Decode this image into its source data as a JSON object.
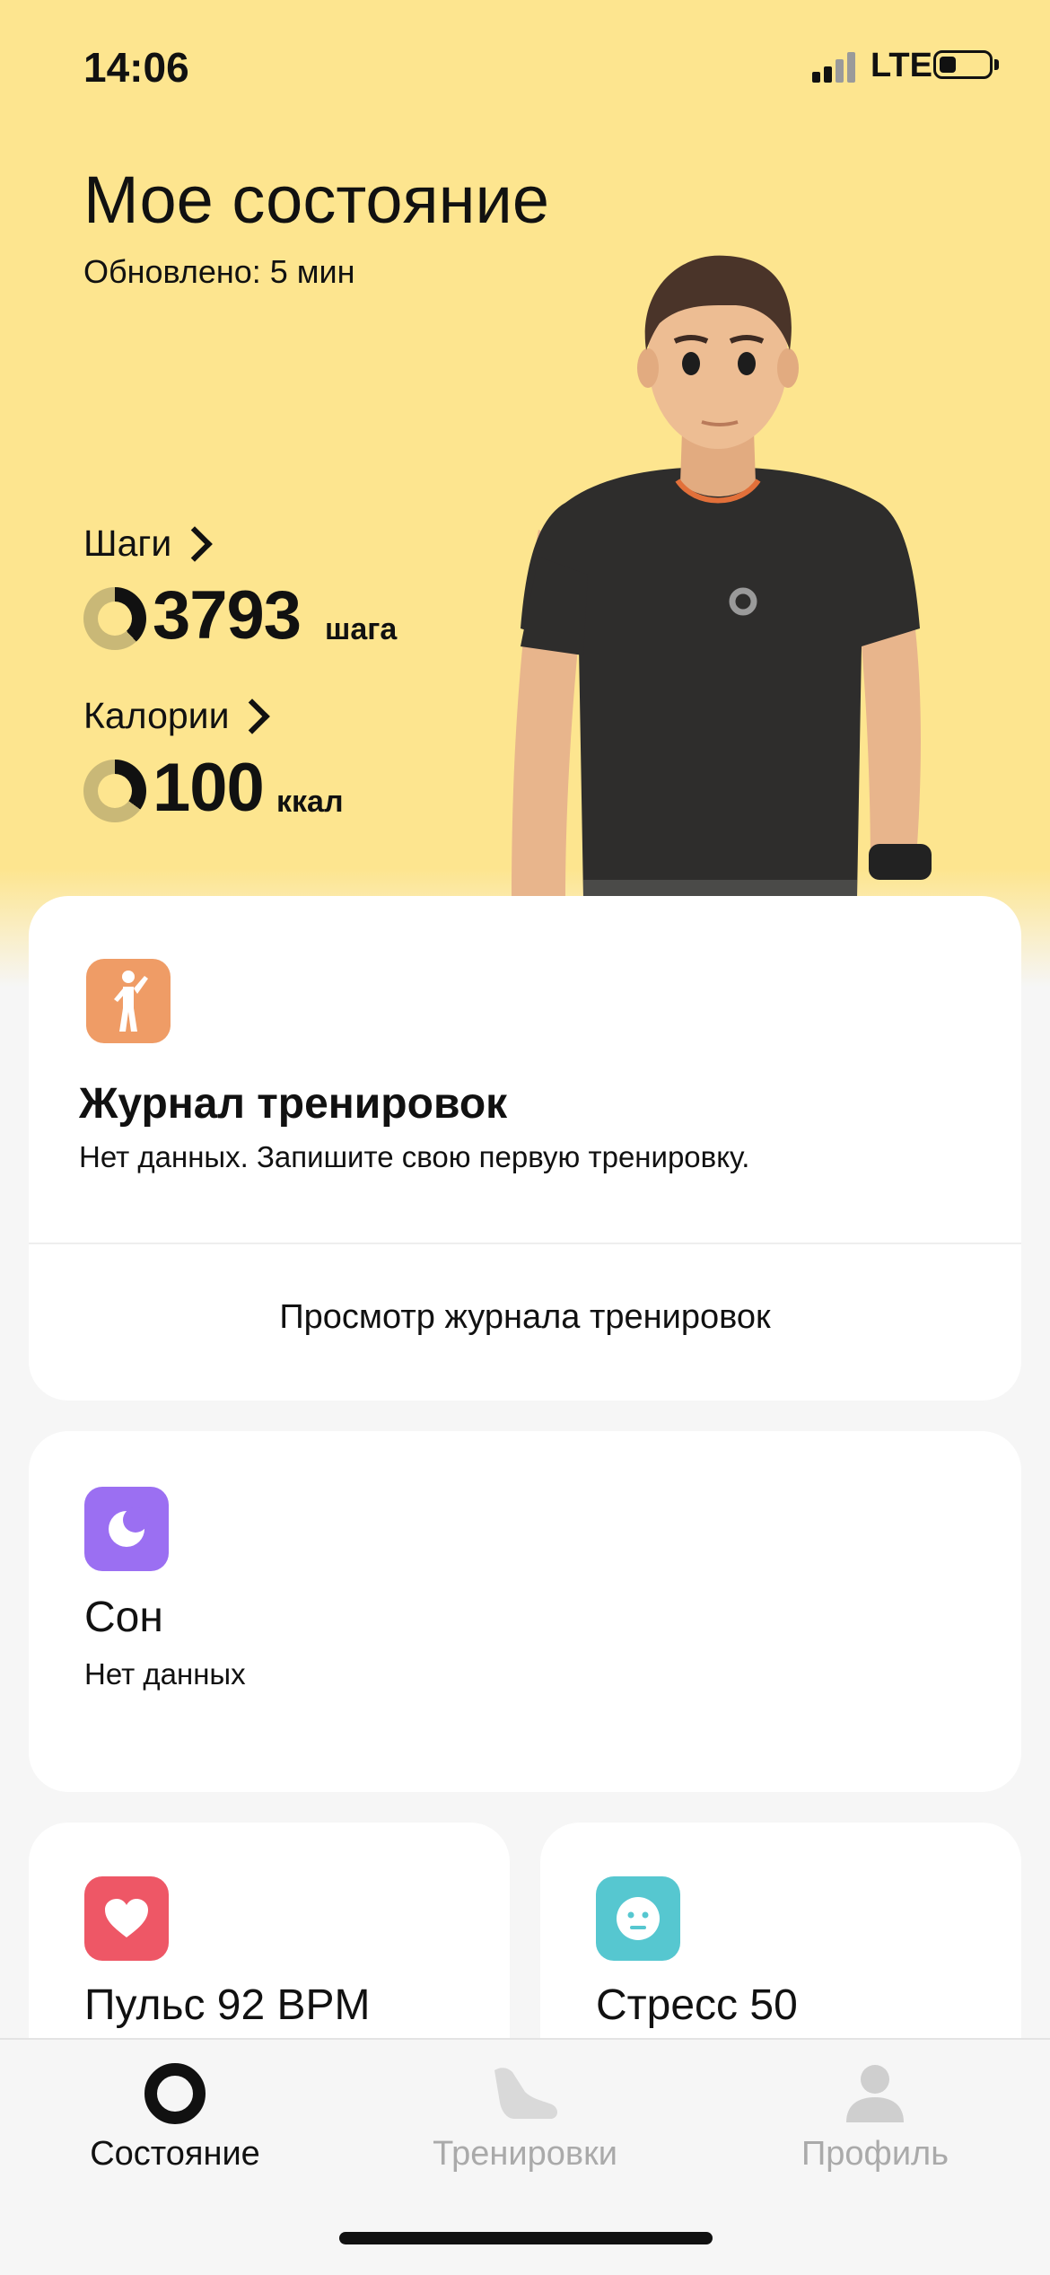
{
  "status_bar": {
    "time": "14:06",
    "network": "LTE"
  },
  "header": {
    "title": "Мое состояние",
    "updated": "Обновлено: 5 мин"
  },
  "metrics": {
    "steps": {
      "label": "Шаги",
      "value": "3793",
      "unit": "шага",
      "progress": 0.38
    },
    "calories": {
      "label": "Калории",
      "value": "100",
      "unit": "ккал",
      "progress": 0.35
    }
  },
  "workout_card": {
    "title": "Журнал тренировок",
    "subtitle": "Нет данных. Запишите свою первую тренировку.",
    "link": "Просмотр журнала тренировок",
    "icon": "person-stretch-icon",
    "icon_color": "#ef9c66"
  },
  "sleep_card": {
    "title": "Сон",
    "subtitle": "Нет данных",
    "icon": "moon-icon",
    "icon_color": "#9b6ff2"
  },
  "pulse_card": {
    "title": "Пульс 92 BPM",
    "icon": "heart-icon",
    "icon_color": "#ee5766"
  },
  "stress_card": {
    "title": "Стресс 50",
    "icon": "neutral-face-icon",
    "icon_color": "#56c7d0"
  },
  "tabs": [
    {
      "label": "Состояние",
      "icon": "ring-icon",
      "active": true
    },
    {
      "label": "Тренировки",
      "icon": "shoe-icon",
      "active": false
    },
    {
      "label": "Профиль",
      "icon": "person-icon",
      "active": false
    }
  ],
  "colors": {
    "hero_bg": "#fde58f",
    "ring_track": "#c9b877",
    "active": "#111111",
    "inactive": "#aaaaaa"
  }
}
